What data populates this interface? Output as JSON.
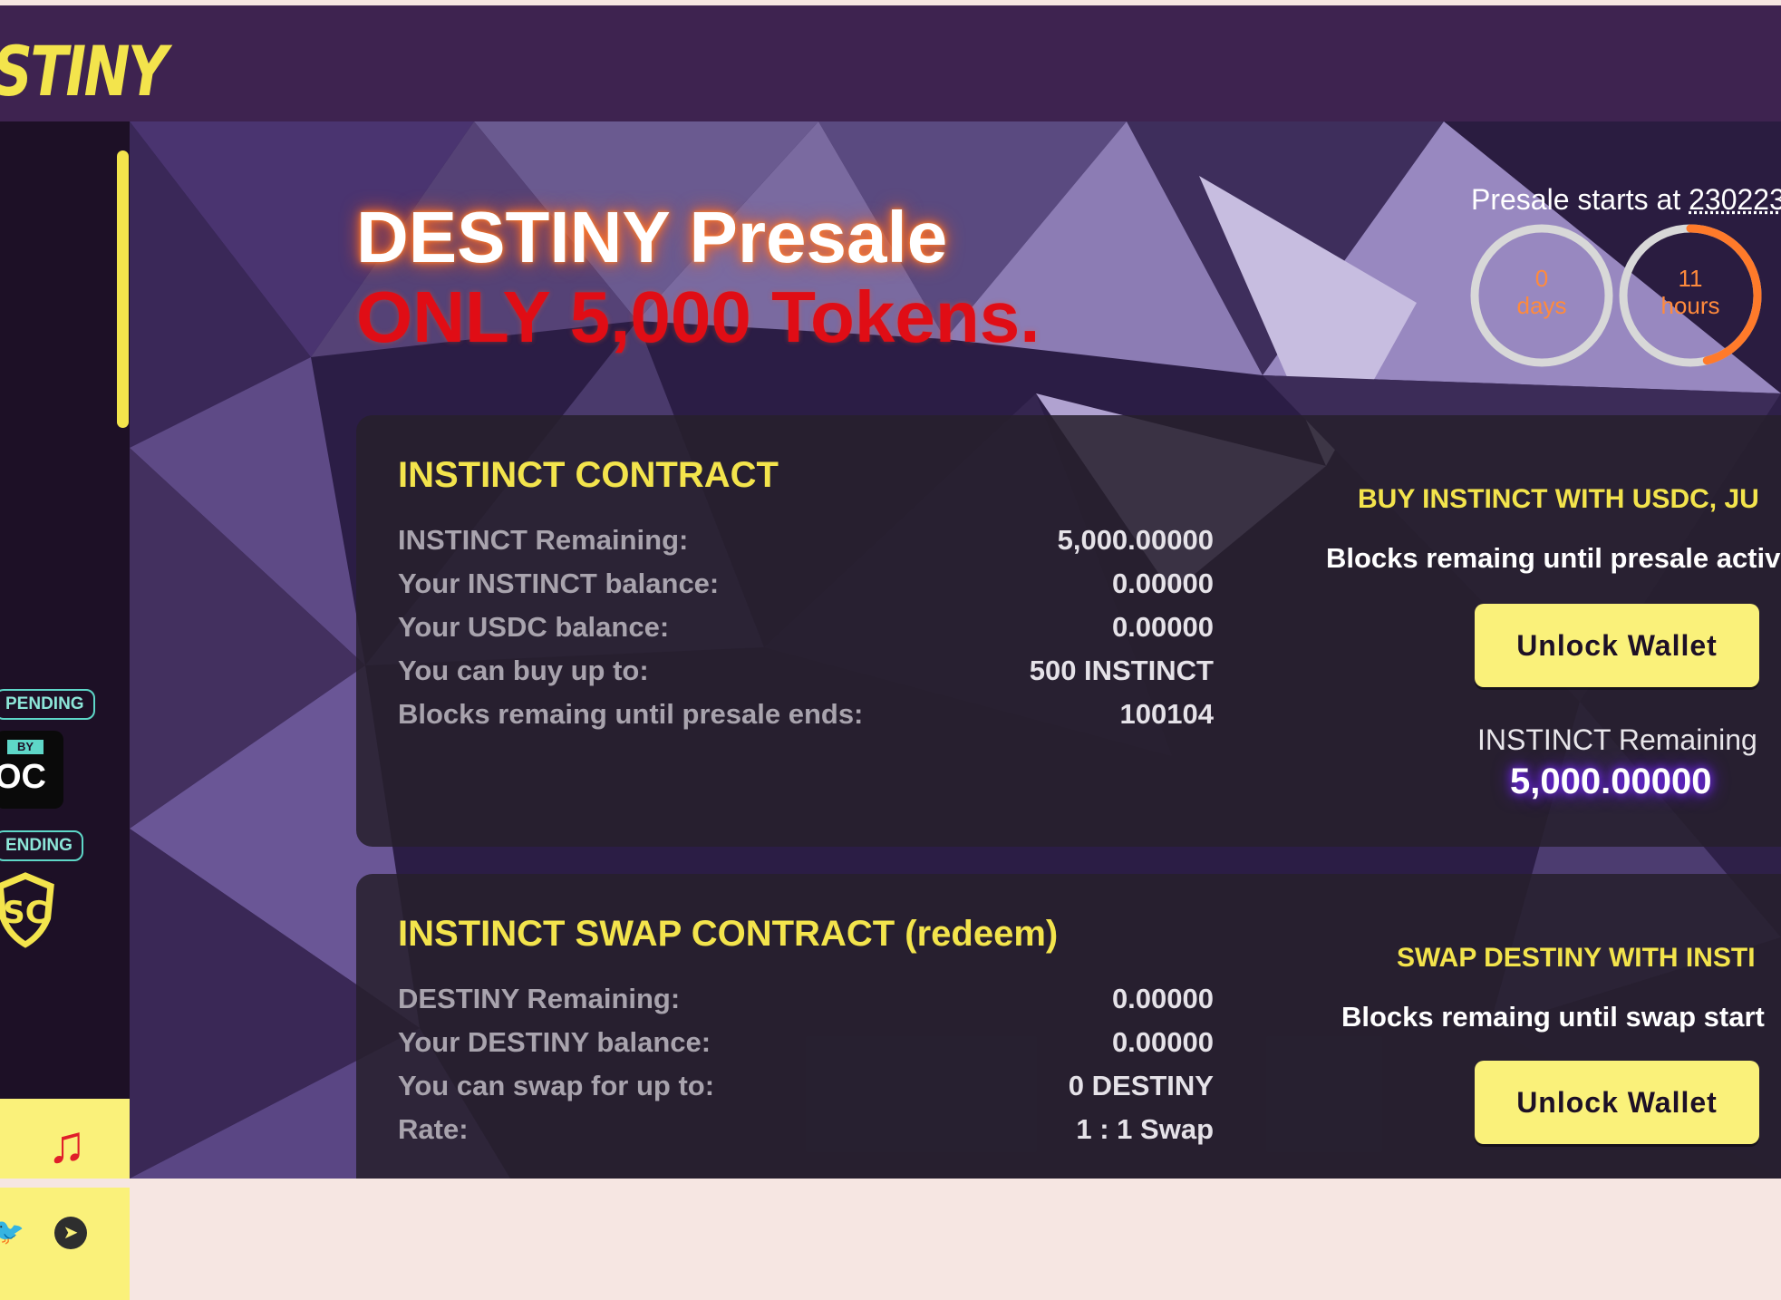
{
  "header": {
    "logo_text": "STINY"
  },
  "sidebar": {
    "badges": [
      {
        "label": "PENDING"
      },
      {
        "label": "ENDING"
      }
    ],
    "kyc": {
      "by": "BY",
      "name": "OC"
    },
    "shield_text": "SC"
  },
  "hero": {
    "title_line1": "DESTINY Presale",
    "title_line2": "ONLY 5,000 Tokens.",
    "presale_label": "Presale starts at ",
    "presale_value": "230223",
    "countdown": [
      {
        "value": "0",
        "unit": "days",
        "fraction": 0
      },
      {
        "value": "11",
        "unit": "hours",
        "fraction": 0.46
      }
    ]
  },
  "instinct_panel": {
    "title": "INSTINCT CONTRACT",
    "rows": [
      {
        "label": "INSTINCT Remaining:",
        "value": "5,000.00000"
      },
      {
        "label": "Your INSTINCT balance:",
        "value": "0.00000"
      },
      {
        "label": "Your USDC balance:",
        "value": "0.00000"
      },
      {
        "label": "You can buy up to:",
        "value": "500 INSTINCT"
      },
      {
        "label": "Blocks remaing until presale ends:",
        "value": "100104"
      }
    ],
    "right_heading": "BUY INSTINCT WITH USDC, JU",
    "right_subtext": "Blocks remaing until presale activ",
    "button_label": "Unlock Wallet",
    "remaining_label": "INSTINCT Remaining",
    "remaining_value": "5,000.00000"
  },
  "swap_panel": {
    "title": "INSTINCT SWAP CONTRACT (redeem)",
    "rows": [
      {
        "label": "DESTINY Remaining:",
        "value": "0.00000"
      },
      {
        "label": "Your DESTINY balance:",
        "value": "0.00000"
      },
      {
        "label": "You can swap for up to:",
        "value": "0 DESTINY"
      },
      {
        "label": "Rate:",
        "value": "1 : 1 Swap"
      }
    ],
    "right_heading": "SWAP DESTINY WITH INSTI",
    "right_subtext": "Blocks remaing until swap start",
    "button_label": "Unlock Wallet"
  },
  "colors": {
    "accent_yellow": "#f3e44c",
    "button_yellow": "#faf17a",
    "header_purple": "#3e2350",
    "countdown_orange": "#ff8a3c",
    "title_red": "#e00d15"
  },
  "icons": [
    "music-icon",
    "telegram-icon",
    "twitter-icon",
    "kyc-badge",
    "audit-shield-icon"
  ]
}
